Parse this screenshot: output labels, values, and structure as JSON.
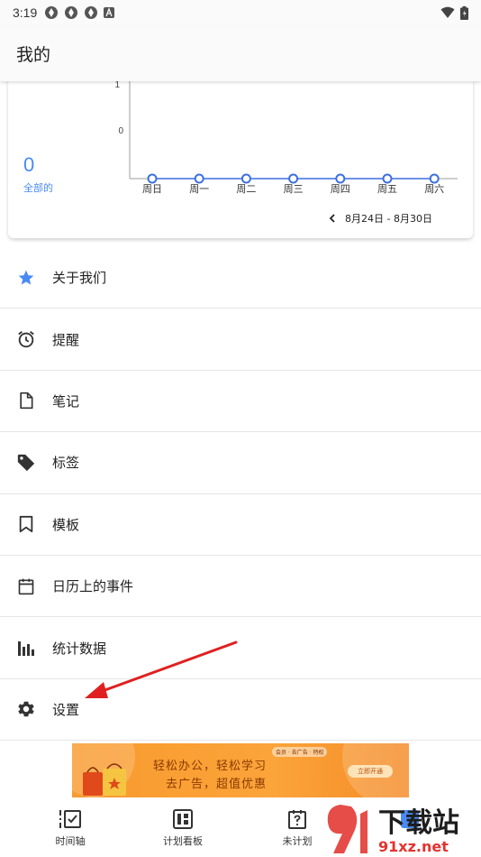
{
  "status_bar": {
    "time": "3:19"
  },
  "app_bar": {
    "title": "我的"
  },
  "stats": {
    "total_value": "0",
    "total_label": "全部的",
    "y_ticks": [
      "1",
      "0"
    ],
    "date_range": "8月24日 - 8月30日"
  },
  "chart_data": {
    "type": "line",
    "categories": [
      "周日",
      "周一",
      "周二",
      "周三",
      "周四",
      "周五",
      "周六"
    ],
    "series": [
      {
        "values": [
          0,
          0,
          0,
          0,
          0,
          0,
          0
        ]
      }
    ],
    "ylim": [
      0,
      1
    ],
    "color": "#3d6fe0"
  },
  "menu": {
    "items": [
      {
        "label": "关于我们",
        "icon": "star-icon"
      },
      {
        "label": "提醒",
        "icon": "alarm-clock-icon"
      },
      {
        "label": "笔记",
        "icon": "note-icon"
      },
      {
        "label": "标签",
        "icon": "tag-icon"
      },
      {
        "label": "模板",
        "icon": "bookmark-icon"
      },
      {
        "label": "日历上的事件",
        "icon": "calendar-icon"
      },
      {
        "label": "统计数据",
        "icon": "bar-chart-icon"
      },
      {
        "label": "设置",
        "icon": "gear-icon"
      }
    ]
  },
  "ad": {
    "line1": "轻松办公，轻松学习",
    "line2": "去广告，超值优惠",
    "tags": "会员 · 去广告 · 特权",
    "button": "立即开通"
  },
  "bottom_nav": {
    "items": [
      {
        "label": "时间轴",
        "icon": "timeline-icon"
      },
      {
        "label": "计划看板",
        "icon": "board-icon"
      },
      {
        "label": "未计划",
        "icon": "unplanned-icon"
      }
    ]
  },
  "watermark": {
    "text1": "下载站",
    "text2": "91xz.net"
  },
  "colors": {
    "accent": "#4a8af4",
    "arrow": "#e02020"
  }
}
